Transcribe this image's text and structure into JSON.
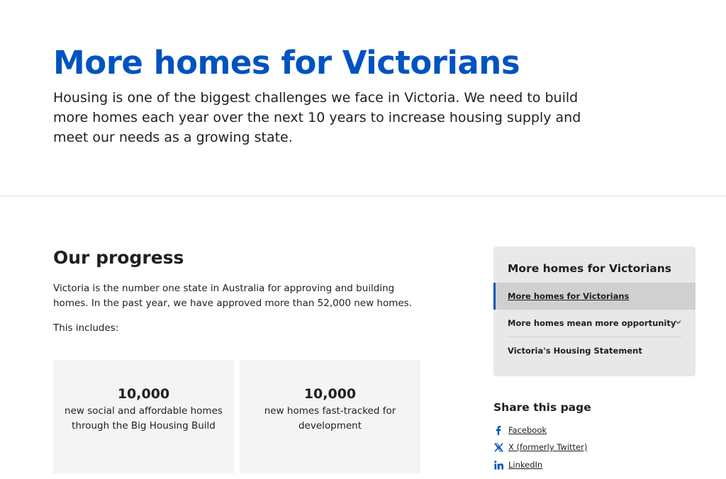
{
  "hero": {
    "title": "More homes for Victorians",
    "intro": "Housing is one of the biggest challenges we face in Victoria. We need to build more homes each year over the next 10 years to increase housing supply and meet our needs as a growing state."
  },
  "progress": {
    "title": "Our progress",
    "paragraph": "Victoria is the number one state in Australia for approving and building homes. In the past year, we have approved more than 52,000 new homes.",
    "includes": "This includes:",
    "stats": [
      {
        "number": "10,000",
        "description": "new social and affordable homes through the Big Housing Build"
      },
      {
        "number": "10,000",
        "description": "new homes fast-tracked for development"
      }
    ]
  },
  "nav": {
    "heading": "More homes for Victorians",
    "items": [
      {
        "label": "More homes for Victorians",
        "active": true
      },
      {
        "label": "More homes mean more opportunity",
        "has_children": true
      },
      {
        "label": "Victoria's Housing Statement"
      }
    ]
  },
  "share": {
    "title": "Share this page",
    "links": [
      {
        "label": "Facebook",
        "icon": "facebook-icon"
      },
      {
        "label": "X (formerly Twitter)",
        "icon": "x-icon"
      },
      {
        "label": "LinkedIn",
        "icon": "linkedin-icon"
      }
    ]
  },
  "colors": {
    "brand_blue": "#0052c2",
    "text": "#201f1e",
    "card_bg": "#f4f4f4",
    "nav_bg": "#e8e8e8",
    "nav_active_bg": "#d0d0d0"
  }
}
